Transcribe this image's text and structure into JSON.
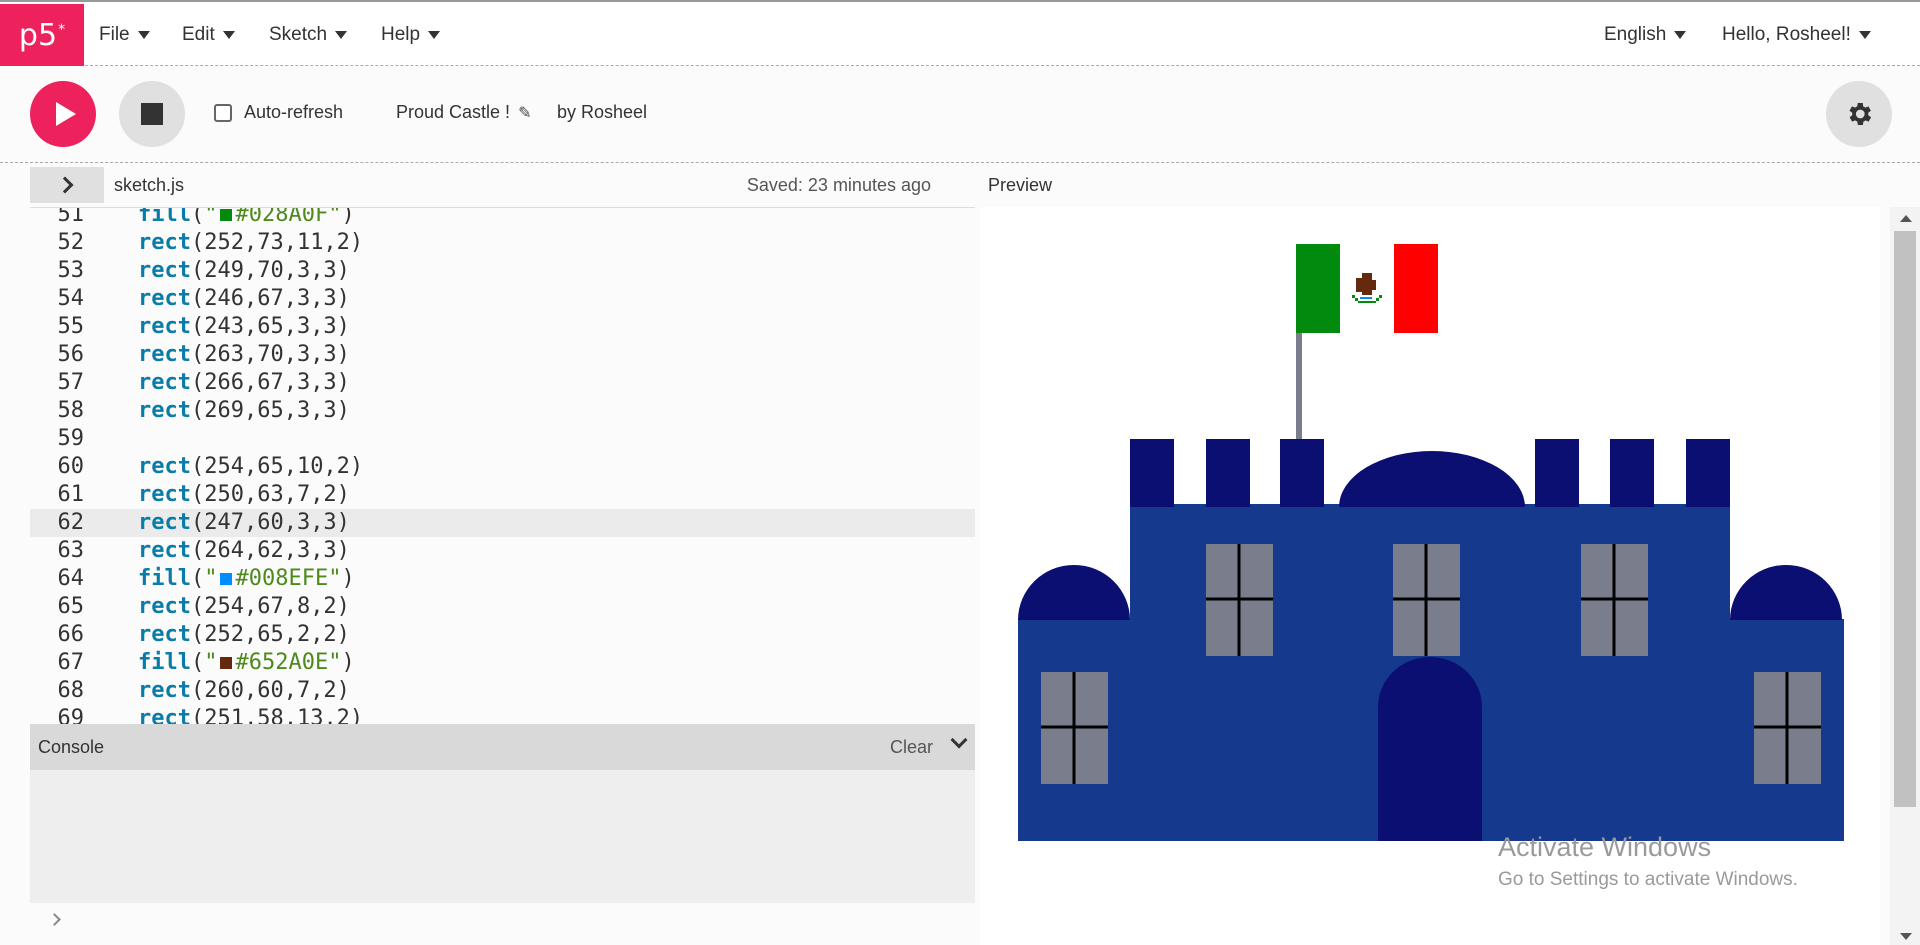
{
  "app": {
    "logo": "p5",
    "logo_sup": "*"
  },
  "menu": {
    "left": [
      {
        "label": "File"
      },
      {
        "label": "Edit"
      },
      {
        "label": "Sketch"
      },
      {
        "label": "Help"
      }
    ],
    "language": "English",
    "user": "Hello, Rosheel!"
  },
  "toolbar": {
    "auto_refresh_label": "Auto-refresh",
    "auto_refresh_checked": false,
    "sketch_name": "Proud Castle !",
    "author": "by Rosheel"
  },
  "editor": {
    "file_name": "sketch.js",
    "saved_status": "Saved: 23 minutes ago",
    "active_line": "62",
    "lines": [
      {
        "no": "51",
        "fn": "fill",
        "args": "\"#028A0F\"",
        "color": "#028A0F"
      },
      {
        "no": "52",
        "fn": "rect",
        "args": "(252,73,11,2)"
      },
      {
        "no": "53",
        "fn": "rect",
        "args": "(249,70,3,3)"
      },
      {
        "no": "54",
        "fn": "rect",
        "args": "(246,67,3,3)"
      },
      {
        "no": "55",
        "fn": "rect",
        "args": "(243,65,3,3)"
      },
      {
        "no": "56",
        "fn": "rect",
        "args": "(263,70,3,3)"
      },
      {
        "no": "57",
        "fn": "rect",
        "args": "(266,67,3,3)"
      },
      {
        "no": "58",
        "fn": "rect",
        "args": "(269,65,3,3)"
      },
      {
        "no": "59",
        "fn": "",
        "args": ""
      },
      {
        "no": "60",
        "fn": "rect",
        "args": "(254,65,10,2)"
      },
      {
        "no": "61",
        "fn": "rect",
        "args": "(250,63,7,2)"
      },
      {
        "no": "62",
        "fn": "rect",
        "args": "(247,60,3,3)"
      },
      {
        "no": "63",
        "fn": "rect",
        "args": "(264,62,3,3)"
      },
      {
        "no": "64",
        "fn": "fill",
        "args": "\"#008EFE\"",
        "color": "#008EFE"
      },
      {
        "no": "65",
        "fn": "rect",
        "args": "(254,67,8,2)"
      },
      {
        "no": "66",
        "fn": "rect",
        "args": "(252,65,2,2)"
      },
      {
        "no": "67",
        "fn": "fill",
        "args": "\"#652A0E\"",
        "color": "#652A0E"
      },
      {
        "no": "68",
        "fn": "rect",
        "args": "(260,60,7,2)"
      },
      {
        "no": "69",
        "fn": "rect",
        "args": "(251,58,13,2)"
      }
    ]
  },
  "console": {
    "title": "Console",
    "clear_label": "Clear"
  },
  "preview": {
    "label": "Preview"
  },
  "watermark": {
    "title": "Activate Windows",
    "subtitle": "Go to Settings to activate Windows."
  },
  "colors": {
    "accent": "#ed225d",
    "castle_wall": "#15398d",
    "castle_dark": "#0c0f72",
    "window": "#7a7e8c",
    "flag_green": "#028A0F",
    "flag_red": "#ff0000",
    "eagle_brown": "#652A0E"
  },
  "icons": {
    "play": "play-icon",
    "stop": "stop-icon",
    "settings": "gear-icon",
    "edit": "pencil-icon"
  }
}
